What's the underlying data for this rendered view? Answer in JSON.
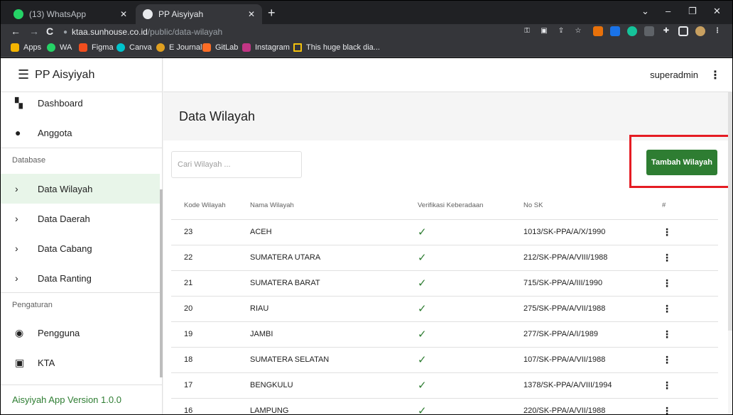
{
  "browser": {
    "tabs": [
      {
        "label": "(13) WhatsApp",
        "close": "✕"
      },
      {
        "label": "PP Aisyiyah",
        "close": "✕"
      }
    ],
    "new_tab": "+",
    "window_controls": [
      "⌄",
      "–",
      "❐",
      "✕"
    ],
    "nav": {
      "back": "←",
      "forward": "→",
      "reload": "C"
    },
    "url": {
      "domain": "ktaa.sunhouse.co.id",
      "path": "/public/data-wilayah"
    },
    "bookmarks": [
      {
        "label": "Apps",
        "color": "#f4b400"
      },
      {
        "label": "WA",
        "color": "#25d366"
      },
      {
        "label": "Figma",
        "color": "#f24e1e"
      },
      {
        "label": "Canva",
        "color": "#00c4cc"
      },
      {
        "label": "E Journal",
        "color": "#e0a020"
      },
      {
        "label": "GitLab",
        "color": "#fc6d26"
      },
      {
        "label": "Instagram",
        "color": "#c13584"
      },
      {
        "label": "This huge black dia...",
        "color": "#f4c20d"
      }
    ]
  },
  "app": {
    "title": "PP Aisyiyah",
    "user": "superadmin",
    "version": "Aisyiyah App Version 1.0.0",
    "accent": "#2e7d32",
    "sidebar": {
      "items_top": [
        {
          "label": "Dashboard",
          "icon": "dashboard-icon"
        },
        {
          "label": "Anggota",
          "icon": "person-icon"
        }
      ],
      "section_database": "Database",
      "items_database": [
        {
          "label": "Data Wilayah",
          "icon": "chevron-right-icon",
          "active": true
        },
        {
          "label": "Data Daerah",
          "icon": "chevron-right-icon"
        },
        {
          "label": "Data Cabang",
          "icon": "chevron-right-icon"
        },
        {
          "label": "Data Ranting",
          "icon": "chevron-right-icon"
        }
      ],
      "section_settings": "Pengaturan",
      "items_settings": [
        {
          "label": "Pengguna",
          "icon": "account-circle-icon"
        },
        {
          "label": "KTA",
          "icon": "badge-icon"
        }
      ]
    },
    "page_title": "Data Wilayah",
    "search_placeholder": "Cari Wilayah ...",
    "add_button": "Tambah Wilayah",
    "table": {
      "headers": [
        "Kode Wilayah",
        "Nama Wilayah",
        "Verifikasi Keberadaan",
        "No SK",
        "#"
      ],
      "rows": [
        {
          "kode": "23",
          "nama": "ACEH",
          "sk": "1013/SK-PPA/A/X/1990"
        },
        {
          "kode": "22",
          "nama": "SUMATERA UTARA",
          "sk": "212/SK-PPA/A/VIII/1988"
        },
        {
          "kode": "21",
          "nama": "SUMATERA BARAT",
          "sk": "715/SK-PPA/A/III/1990"
        },
        {
          "kode": "20",
          "nama": "RIAU",
          "sk": "275/SK-PPA/A/VII/1988"
        },
        {
          "kode": "19",
          "nama": "JAMBI",
          "sk": "277/SK-PPA/A/I/1989"
        },
        {
          "kode": "18",
          "nama": "SUMATERA SELATAN",
          "sk": "107/SK-PPA/A/VII/1988"
        },
        {
          "kode": "17",
          "nama": "BENGKULU",
          "sk": "1378/SK-PPA/A/VIII/1994"
        },
        {
          "kode": "16",
          "nama": "LAMPUNG",
          "sk": "220/SK-PPA/A/VII/1988"
        }
      ]
    }
  }
}
